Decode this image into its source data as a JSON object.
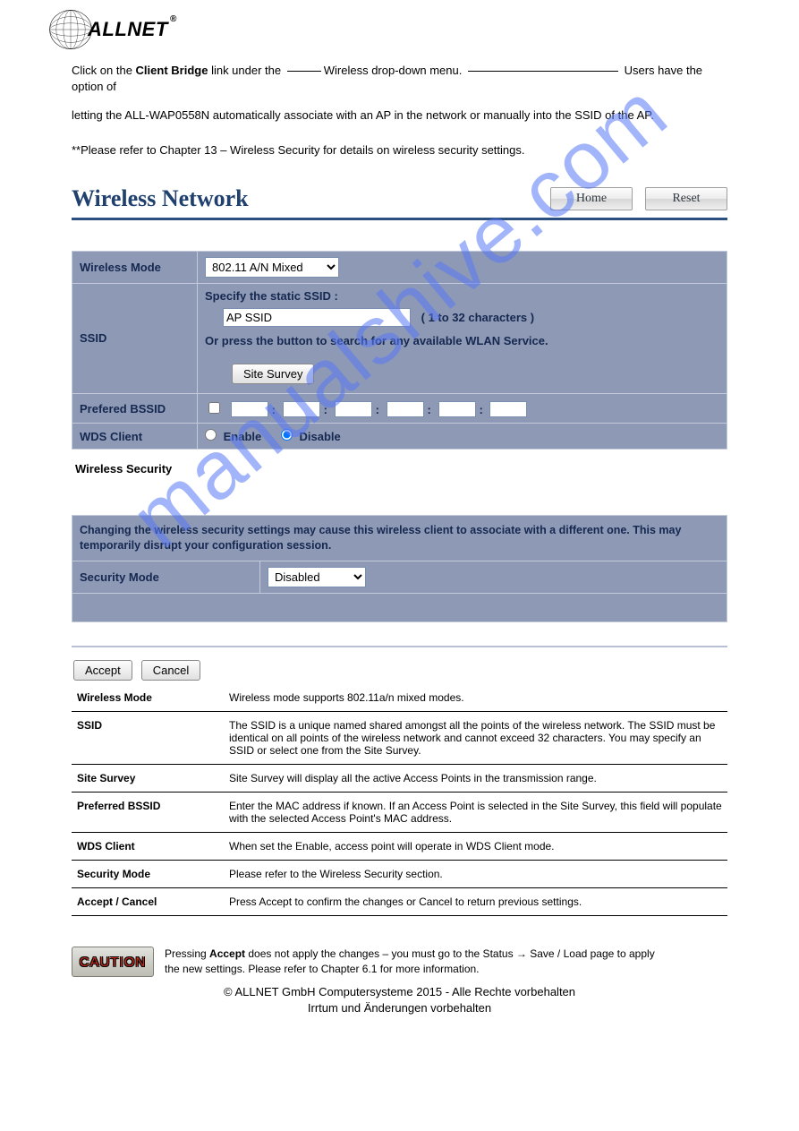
{
  "logo": {
    "text": "ALLNET",
    "reg": "®"
  },
  "intro": {
    "line1a": "Click on the ",
    "line1b": "Client Bridge",
    "line1c": " link under the ",
    "line1d": "Wireless",
    "line1e": " drop-down menu. ",
    "line1f": " Users have the option of ",
    "line2a": "letting the ALL-WAP0558N automatically associate with an AP in the network or manually into the ",
    "line2b": "SSID of the AP.",
    "note": "**Please refer to Chapter 13 – Wireless Security for details on wireless security settings."
  },
  "panel": {
    "title": "Wireless Network",
    "home_btn": "Home",
    "reset_btn": "Reset"
  },
  "form": {
    "wireless_mode_label": "Wireless Mode",
    "wireless_mode_value": "802.11 A/N Mixed",
    "ssid_label": "SSID",
    "ssid_line1": "Specify the static SSID  :",
    "ssid_value": "AP SSID",
    "ssid_note": "( 1 to 32 characters )",
    "ssid_line2": "Or press the button to search for any available WLAN Service.",
    "site_survey": "Site Survey",
    "bssid_label": "Prefered BSSID",
    "wds_label": "WDS Client",
    "wds_enable": "Enable",
    "wds_disable": "Disable",
    "sec_header": "Wireless Security",
    "sec_warning": "Changing the wireless security settings may cause this wireless client to associate with a different one. This may temporarily disrupt your configuration session.",
    "sec_mode_label": "Security Mode",
    "sec_mode_value": "Disabled",
    "accept": "Accept",
    "cancel": "Cancel"
  },
  "desc": {
    "rows": [
      {
        "k": "Wireless Mode",
        "v": "Wireless mode supports 802.11a/n mixed modes."
      },
      {
        "k": "SSID",
        "v": "The SSID is a unique named shared amongst all the points of the wireless network. The SSID must be identical on all points of the wireless network and cannot exceed 32 characters. You may specify an SSID or select one from the Site Survey."
      },
      {
        "k": "Site Survey",
        "v": "Site Survey will display all the active Access Points in the transmission range."
      },
      {
        "k": "Preferred BSSID",
        "v": "Enter the MAC address if known. If an Access Point is selected in the Site Survey, this field will populate with the selected Access Point's MAC address."
      },
      {
        "k": "WDS Client",
        "v": "When set the Enable, access point will operate in WDS Client mode."
      },
      {
        "k": "Security Mode",
        "v": "Please refer to the Wireless Security section."
      },
      {
        "k": "Accept / Cancel",
        "v": "Press Accept to confirm the changes or Cancel to return previous settings."
      }
    ]
  },
  "caution": {
    "badge": "CAUTION",
    "text_a": "Pressing ",
    "text_b": "Accept",
    "text_c": " does not apply the changes – you must go to the Status → Save / Load page to apply the new settings.  Please refer to Chapter 6.1 for more information."
  },
  "footer": {
    "l1": "© ALLNET GmbH Computersysteme 2015 -    Alle Rechte vorbehalten",
    "l2": "Irrtum und Änderungen vorbehalten"
  }
}
